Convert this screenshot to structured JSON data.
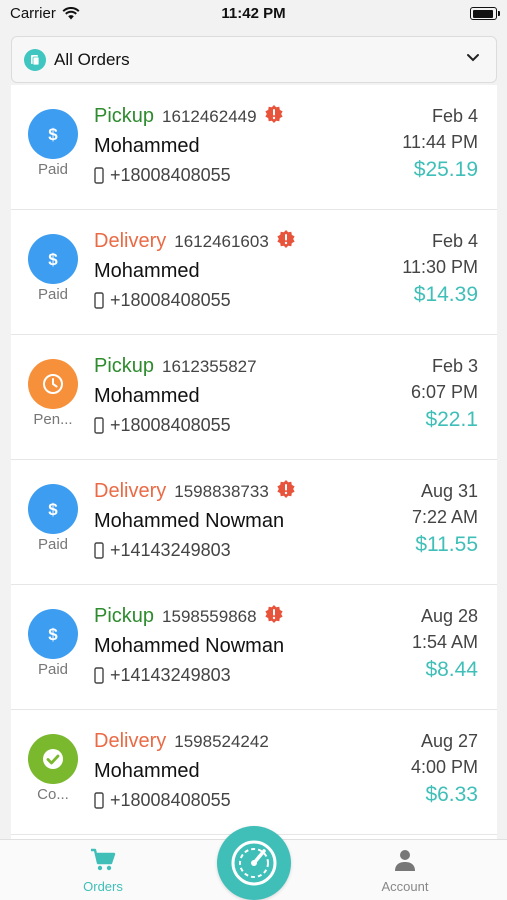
{
  "status_bar": {
    "carrier": "Carrier",
    "time": "11:42 PM"
  },
  "filter": {
    "label": "All Orders"
  },
  "orders": [
    {
      "type": "Pickup",
      "number": "1612462449",
      "alert": true,
      "customer": "Mohammed",
      "phone": "+18008408055",
      "date": "Feb 4",
      "time": "11:44 PM",
      "amount": "$25.19",
      "status": "Paid",
      "status_kind": "paid"
    },
    {
      "type": "Delivery",
      "number": "1612461603",
      "alert": true,
      "customer": "Mohammed",
      "phone": "+18008408055",
      "date": "Feb 4",
      "time": "11:30 PM",
      "amount": "$14.39",
      "status": "Paid",
      "status_kind": "paid"
    },
    {
      "type": "Pickup",
      "number": "1612355827",
      "alert": false,
      "customer": "Mohammed",
      "phone": "+18008408055",
      "date": "Feb 3",
      "time": "6:07 PM",
      "amount": "$22.1",
      "status": "Pen...",
      "status_kind": "pending"
    },
    {
      "type": "Delivery",
      "number": "1598838733",
      "alert": true,
      "customer": "Mohammed Nowman",
      "phone": "+14143249803",
      "date": "Aug 31",
      "time": "7:22 AM",
      "amount": "$11.55",
      "status": "Paid",
      "status_kind": "paid"
    },
    {
      "type": "Pickup",
      "number": "1598559868",
      "alert": true,
      "customer": "Mohammed Nowman",
      "phone": "+14143249803",
      "date": "Aug 28",
      "time": "1:54 AM",
      "amount": "$8.44",
      "status": "Paid",
      "status_kind": "paid"
    },
    {
      "type": "Delivery",
      "number": "1598524242",
      "alert": false,
      "customer": "Mohammed",
      "phone": "+18008408055",
      "date": "Aug 27",
      "time": "4:00 PM",
      "amount": "$6.33",
      "status": "Co...",
      "status_kind": "complete"
    }
  ],
  "tabs": {
    "orders": "Orders",
    "account": "Account"
  },
  "colors": {
    "accent": "#3fbfb8",
    "pickup": "#2e8b2e",
    "delivery": "#ea6a45",
    "paid": "#3d9df0",
    "pending": "#f7903a",
    "complete": "#7ab82e",
    "alert": "#e8533c"
  }
}
